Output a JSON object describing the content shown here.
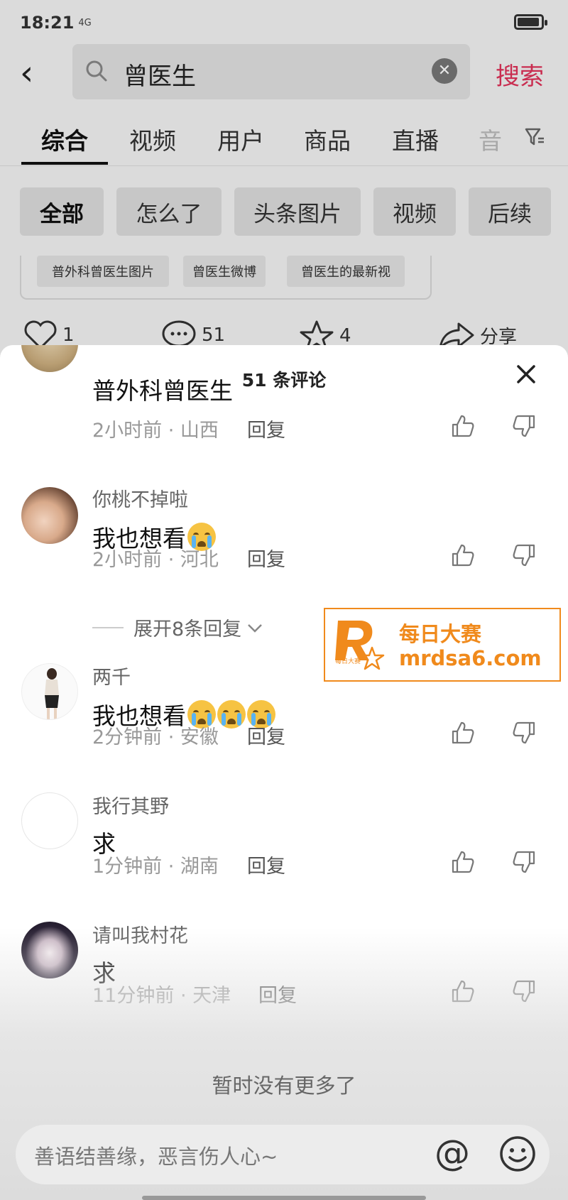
{
  "status_bar": {
    "time": "18:21",
    "signal": "4G"
  },
  "search": {
    "query": "曾医生",
    "action_label": "搜索"
  },
  "tabs": [
    {
      "label": "综合"
    },
    {
      "label": "视频"
    },
    {
      "label": "用户"
    },
    {
      "label": "商品"
    },
    {
      "label": "直播"
    },
    {
      "label": "音"
    }
  ],
  "chips": [
    {
      "label": "全部"
    },
    {
      "label": "怎么了"
    },
    {
      "label": "头条图片"
    },
    {
      "label": "视频"
    },
    {
      "label": "后续"
    }
  ],
  "related_tags": [
    {
      "label": "普外科曾医生图片"
    },
    {
      "label": "曾医生微博"
    },
    {
      "label": "曾医生的最新视"
    }
  ],
  "post_actions": {
    "likes": "1",
    "comments": "51",
    "favorites": "4",
    "share_label": "分享"
  },
  "comments_panel": {
    "title": "51 条评论",
    "reply_label": "回复",
    "comments": [
      {
        "user": "",
        "text": "普外科曾医生",
        "meta": "2小时前 · 山西"
      },
      {
        "user": "你桃不掉啦",
        "text": "我也想看",
        "emojis": 1,
        "meta": "2小时前 · 河北"
      },
      {
        "user": "两千",
        "text": "我也想看",
        "emojis": 3,
        "meta": "2分钟前 · 安徽"
      },
      {
        "user": "我行其野",
        "text": "求",
        "meta": "1分钟前 · 湖南"
      },
      {
        "user": "请叫我村花",
        "text": "求",
        "meta": "11分钟前 · 天津"
      }
    ],
    "expand_replies": "展开8条回复",
    "no_more": "暂时没有更多了",
    "input_placeholder": "善语结善缘，恶言伤人心~",
    "at_symbol": "@"
  },
  "watermark": {
    "title": "每日大赛",
    "url": "mrdsa6.com",
    "small_text": "每日大赛"
  },
  "colors": {
    "accent": "#e0335a",
    "watermark": "#f08a1c"
  }
}
